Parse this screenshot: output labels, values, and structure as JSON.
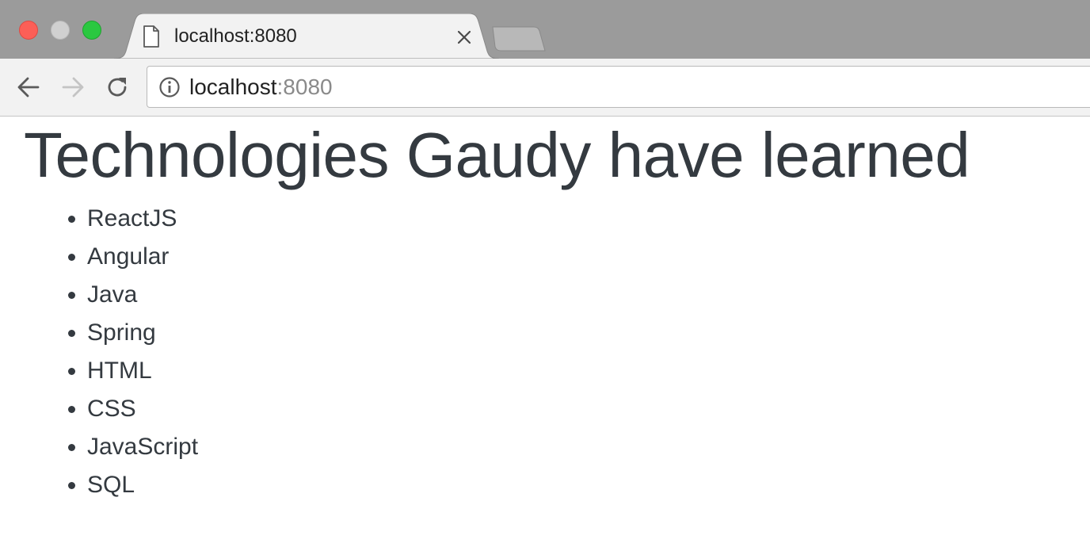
{
  "browser": {
    "tab": {
      "title": "localhost:8080",
      "close_symbol": "×"
    },
    "icons": {
      "favicon": "document-icon",
      "close": "close-icon",
      "back": "back-arrow-icon",
      "forward": "forward-arrow-icon",
      "reload": "reload-icon",
      "site_info": "info-icon"
    },
    "address_bar": {
      "host": "localhost",
      "port": ":8080"
    },
    "colors": {
      "tabstrip": "#9b9b9b",
      "toolbar": "#f2f2f2",
      "close_button": "#fc5f57",
      "minimize_button": "#d0d0d0",
      "maximize_button": "#2ac840"
    }
  },
  "page": {
    "title": "Technologies Gaudy have learned",
    "technologies": [
      "ReactJS",
      "Angular",
      "Java",
      "Spring",
      "HTML",
      "CSS",
      "JavaScript",
      "SQL"
    ],
    "text_color": "#343a40"
  }
}
